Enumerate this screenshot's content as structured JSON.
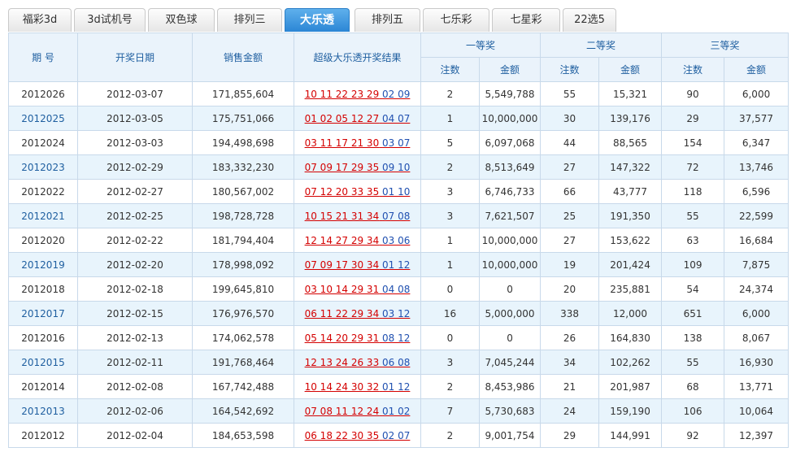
{
  "tabs": [
    "福彩3d",
    "3d试机号",
    "双色球",
    "排列三",
    "大乐透",
    "排列五",
    "七乐彩",
    "七星彩",
    "22选5"
  ],
  "active_tab": 4,
  "headers": {
    "period": "期  号",
    "date": "开奖日期",
    "sales": "销售金额",
    "result": "超级大乐透开奖结果",
    "prize1": "一等奖",
    "prize2": "二等奖",
    "prize3": "三等奖",
    "count": "注数",
    "amount": "金额"
  },
  "rows": [
    {
      "period": "2012026",
      "date": "2012-03-07",
      "sales": "171,855,604",
      "front": "10 11 22 23 29",
      "back": "02 09",
      "c1": "2",
      "a1": "5,549,788",
      "c2": "55",
      "a2": "15,321",
      "c3": "90",
      "a3": "6,000"
    },
    {
      "period": "2012025",
      "date": "2012-03-05",
      "sales": "175,751,066",
      "front": "01 02 05 12 27",
      "back": "04 07",
      "c1": "1",
      "a1": "10,000,000",
      "c2": "30",
      "a2": "139,176",
      "c3": "29",
      "a3": "37,577"
    },
    {
      "period": "2012024",
      "date": "2012-03-03",
      "sales": "194,498,698",
      "front": "03 11 17 21 30",
      "back": "03 07",
      "c1": "5",
      "a1": "6,097,068",
      "c2": "44",
      "a2": "88,565",
      "c3": "154",
      "a3": "6,347"
    },
    {
      "period": "2012023",
      "date": "2012-02-29",
      "sales": "183,332,230",
      "front": "07 09 17 29 35",
      "back": "09 10",
      "c1": "2",
      "a1": "8,513,649",
      "c2": "27",
      "a2": "147,322",
      "c3": "72",
      "a3": "13,746"
    },
    {
      "period": "2012022",
      "date": "2012-02-27",
      "sales": "180,567,002",
      "front": "07 12 20 33 35",
      "back": "01 10",
      "c1": "3",
      "a1": "6,746,733",
      "c2": "66",
      "a2": "43,777",
      "c3": "118",
      "a3": "6,596"
    },
    {
      "period": "2012021",
      "date": "2012-02-25",
      "sales": "198,728,728",
      "front": "10 15 21 31 34",
      "back": "07 08",
      "c1": "3",
      "a1": "7,621,507",
      "c2": "25",
      "a2": "191,350",
      "c3": "55",
      "a3": "22,599"
    },
    {
      "period": "2012020",
      "date": "2012-02-22",
      "sales": "181,794,404",
      "front": "12 14 27 29 34",
      "back": "03 06",
      "c1": "1",
      "a1": "10,000,000",
      "c2": "27",
      "a2": "153,622",
      "c3": "63",
      "a3": "16,684"
    },
    {
      "period": "2012019",
      "date": "2012-02-20",
      "sales": "178,998,092",
      "front": "07 09 17 30 34",
      "back": "01 12",
      "c1": "1",
      "a1": "10,000,000",
      "c2": "19",
      "a2": "201,424",
      "c3": "109",
      "a3": "7,875"
    },
    {
      "period": "2012018",
      "date": "2012-02-18",
      "sales": "199,645,810",
      "front": "03 10 14 29 31",
      "back": "04 08",
      "c1": "0",
      "a1": "0",
      "c2": "20",
      "a2": "235,881",
      "c3": "54",
      "a3": "24,374"
    },
    {
      "period": "2012017",
      "date": "2012-02-15",
      "sales": "176,976,570",
      "front": "06 11 22 29 34",
      "back": "03 12",
      "c1": "16",
      "a1": "5,000,000",
      "c2": "338",
      "a2": "12,000",
      "c3": "651",
      "a3": "6,000"
    },
    {
      "period": "2012016",
      "date": "2012-02-13",
      "sales": "174,062,578",
      "front": "05 14 20 29 31",
      "back": "08 12",
      "c1": "0",
      "a1": "0",
      "c2": "26",
      "a2": "164,830",
      "c3": "138",
      "a3": "8,067"
    },
    {
      "period": "2012015",
      "date": "2012-02-11",
      "sales": "191,768,464",
      "front": "12 13 24 26 33",
      "back": "06 08",
      "c1": "3",
      "a1": "7,045,244",
      "c2": "34",
      "a2": "102,262",
      "c3": "55",
      "a3": "16,930"
    },
    {
      "period": "2012014",
      "date": "2012-02-08",
      "sales": "167,742,488",
      "front": "10 14 24 30 32",
      "back": "01 12",
      "c1": "2",
      "a1": "8,453,986",
      "c2": "21",
      "a2": "201,987",
      "c3": "68",
      "a3": "13,771"
    },
    {
      "period": "2012013",
      "date": "2012-02-06",
      "sales": "164,542,692",
      "front": "07 08 11 12 24",
      "back": "01 02",
      "c1": "7",
      "a1": "5,730,683",
      "c2": "24",
      "a2": "159,190",
      "c3": "106",
      "a3": "10,064"
    },
    {
      "period": "2012012",
      "date": "2012-02-04",
      "sales": "184,653,598",
      "front": "06 18 22 30 35",
      "back": "02 07",
      "c1": "2",
      "a1": "9,001,754",
      "c2": "29",
      "a2": "144,991",
      "c3": "92",
      "a3": "12,397"
    }
  ]
}
